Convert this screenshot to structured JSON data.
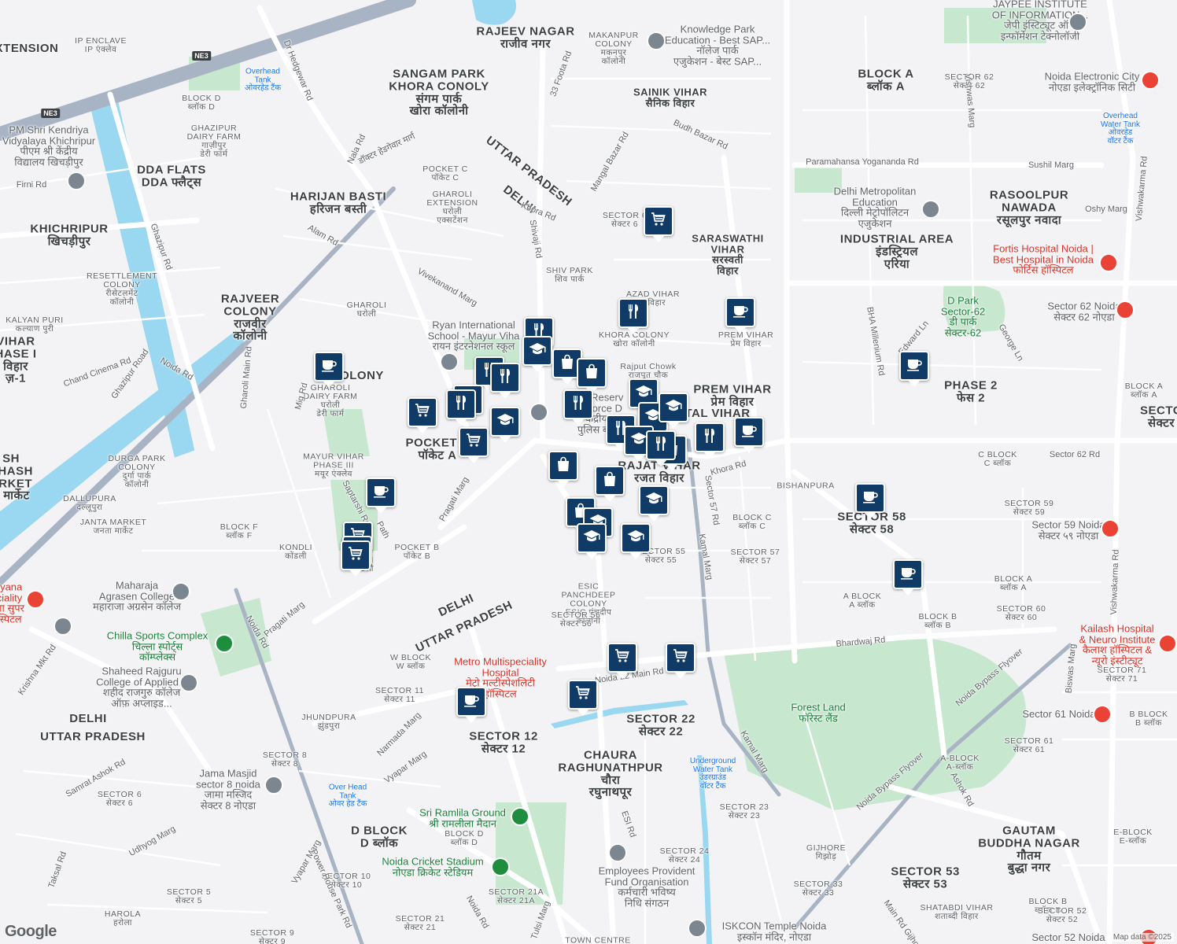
{
  "attribution": "Map data ©2025",
  "logo": "Google",
  "highway_shields": [
    "NE3",
    "NE3"
  ],
  "colors": {
    "marker": "#0f3b66",
    "water": "#9ad7f0",
    "park": "#c7e7cf",
    "highway": "#a8b4c4"
  },
  "areas": [
    {
      "id": "rajeev-nagar",
      "text": "RAJEEV NAGAR\nराजीव नगर",
      "cls": "area"
    },
    {
      "id": "sangam-park",
      "text": "SANGAM PARK\nKHORA CONOLY\nसंगम पार्क\nखोरा कॉलोनी",
      "cls": "area"
    },
    {
      "id": "extension",
      "text": "XTENSION",
      "cls": "area"
    },
    {
      "id": "dda-flats",
      "text": "DDA FLATS\nDDA फ्लैट्स",
      "cls": "area"
    },
    {
      "id": "harijan-basti",
      "text": "HARIJAN BASTI\nहरिजन बस्ती",
      "cls": "area"
    },
    {
      "id": "khichripur",
      "text": "KHICHRIPUR\nखिचड़ीपुर",
      "cls": "area"
    },
    {
      "id": "rajveer-colony",
      "text": "RAJVEER\nCOLONY\nराजवीर\nकॉलोनी",
      "cls": "area"
    },
    {
      "id": "vihar-phase",
      "text": "VIHAR\nHASE I\nविहार\nज़-1",
      "cls": "area"
    },
    {
      "id": "colony-w",
      "text": "OLONY",
      "cls": "area"
    },
    {
      "id": "pocket-a",
      "text": "POCKET A\nपॉकेट A",
      "cls": "area"
    },
    {
      "id": "subhash-market",
      "text": "SH\nBHASH\nARKET\nष मार्केट",
      "cls": "area"
    },
    {
      "id": "uttar-pradesh-n",
      "text": "UTTAR PRADESH",
      "cls": "area"
    },
    {
      "id": "delhi-n",
      "text": "DELHI",
      "cls": "area"
    },
    {
      "id": "block-a",
      "text": "BLOCK A\nब्लॉक A",
      "cls": "area"
    },
    {
      "id": "rasoolpur",
      "text": "RASOOLPUR\nNAWADA\nरसूलपुर नवादा",
      "cls": "area"
    },
    {
      "id": "industrial-area",
      "text": "INDUSTRIAL AREA\nइंडस्ट्रियल\nएरिया",
      "cls": "area"
    },
    {
      "id": "prem-vihar",
      "text": "PREM VIHAR\nप्रेम विहार",
      "cls": "area"
    },
    {
      "id": "sheetal-vihar",
      "text": "TAL VIHAR",
      "cls": "area"
    },
    {
      "id": "rajat-vihar",
      "text": "RAJAT VIHAR\nरजत विहार",
      "cls": "area"
    },
    {
      "id": "phase-2",
      "text": "PHASE 2\nफेस 2",
      "cls": "area"
    },
    {
      "id": "sector-58",
      "text": "SECTOR 58\nसेक्टर 58",
      "cls": "area"
    },
    {
      "id": "sector-n",
      "text": "SECTO\nसेक्टर",
      "cls": "area"
    },
    {
      "id": "delhi-s",
      "text": "DELHI",
      "cls": "area"
    },
    {
      "id": "uttar-pradesh-s",
      "text": "UTTAR PRADESH",
      "cls": "area"
    },
    {
      "id": "delhi-sw",
      "text": "DELHI",
      "cls": "area"
    },
    {
      "id": "uttar-pradesh-sw",
      "text": "UTTAR PRADESH",
      "cls": "area"
    },
    {
      "id": "sector-12",
      "text": "SECTOR 12\nसेक्टर 12",
      "cls": "area"
    },
    {
      "id": "sector-22",
      "text": "SECTOR 22\nसेक्टर 22",
      "cls": "area"
    },
    {
      "id": "chaura",
      "text": "CHAURA\nRAGHUNATHPUR\nचौरा\nरघुनाथपूर",
      "cls": "area"
    },
    {
      "id": "d-block",
      "text": "D BLOCK\nD ब्लॉक",
      "cls": "area"
    },
    {
      "id": "gautam-buddha",
      "text": "GAUTAM\nBUDDHA NAGAR\nगौतम\nबुद्धा नगर",
      "cls": "area"
    },
    {
      "id": "sector-53",
      "text": "SECTOR 53\nसेक्टर 53",
      "cls": "area"
    }
  ],
  "small_labels": [
    {
      "id": "ip-enclave",
      "text": "IP ENCLAVE\nIP एंक्लेव"
    },
    {
      "id": "block-d-n",
      "text": "BLOCK D\nब्लॉक D"
    },
    {
      "id": "ghazipur-dairy",
      "text": "GHAZIPUR\nDAIRY FARM\nगाज़ीपुर\nडेरी फार्म"
    },
    {
      "id": "pocket-c",
      "text": "POCKET C\nपॉकेट C"
    },
    {
      "id": "gharoli-ext",
      "text": "GHAROLI\nEXTENSION\nघरोली\nएक्सटेंशन"
    },
    {
      "id": "makanpur",
      "text": "MAKANPUR\nCOLONY\nमकनपुर\nकॉलोनी"
    },
    {
      "id": "sainik-vihar",
      "text": "SAINIK VIHAR\nसैनिक विहार",
      "area": true
    },
    {
      "id": "sector-6x",
      "text": "SECTOR 6\nसेक्टर 6"
    },
    {
      "id": "saraswathi",
      "text": "SARASWATHI\nVIHAR\nसरस्वती\nविहार",
      "area": true
    },
    {
      "id": "shiv-park",
      "text": "SHIV PARK\nशिव पार्क"
    },
    {
      "id": "azad-vihar",
      "text": "AZAD VIHAR\nद विहार"
    },
    {
      "id": "khora-colony",
      "text": "KHORA COLONY\nखोरा कॉलोनी"
    },
    {
      "id": "prem-vihar-s",
      "text": "PREM VIHAR\nप्रेम विहार"
    },
    {
      "id": "rajput-chowk",
      "text": "Rajput Chowk\nराजपूत चौक"
    },
    {
      "id": "resettlement",
      "text": "RESETTLEMENT\nCOLONY\nरीसेटलमेंट\nकॉलोनी"
    },
    {
      "id": "kalyan-puri",
      "text": "KALYAN PURI\nकल्याण पुरी"
    },
    {
      "id": "gharoli",
      "text": "GHAROLI\nघरोली"
    },
    {
      "id": "gharoli-dairy",
      "text": "GHAROLI\nDAIRY FARM\nघरोली\nडेरी फार्म"
    },
    {
      "id": "durga-park",
      "text": "DURGA PARK\nCOLONY\nदुर्गा पार्क\nकॉलोनी"
    },
    {
      "id": "dallupura",
      "text": "DALLUPURA\nदल्लूपुरा"
    },
    {
      "id": "janta-market",
      "text": "JANTA MARKET\nजनता मार्केट"
    },
    {
      "id": "mayur-vihar-3",
      "text": "MAYUR VIHAR\nPHASE III\nमयूर एंक्लेव"
    },
    {
      "id": "block-f",
      "text": "BLOCK F\nब्लॉक F"
    },
    {
      "id": "kondli",
      "text": "KONDLI\nकोंडली"
    },
    {
      "id": "kondli-2",
      "text": "NDLI\nोंडली"
    },
    {
      "id": "pocket-b",
      "text": "POCKET B\nपॉकेट B"
    },
    {
      "id": "sector-55",
      "text": "SECTOR 55\nसेक्टर 55"
    },
    {
      "id": "sector-57",
      "text": "SECTOR 57\nसेक्टर 57"
    },
    {
      "id": "block-c",
      "text": "BLOCK C\nब्लॉक C"
    },
    {
      "id": "bishanpura",
      "text": "BISHANPURA"
    },
    {
      "id": "esic",
      "text": "ESIC\nPANCHDEEP\nCOLONY\nESIC पंचदीप\nकॉलोनी"
    },
    {
      "id": "sector-56",
      "text": "SECTOR 56\nसेक्टर 56"
    },
    {
      "id": "w-block",
      "text": "W BLOCK\nW ब्लॉक"
    },
    {
      "id": "sector-11",
      "text": "SECTOR 11\nसेक्टर 11"
    },
    {
      "id": "jhundpura",
      "text": "JHUNDPURA\nझुंडपुरा"
    },
    {
      "id": "sector-8",
      "text": "SECTOR 8\nसेक्टर 8"
    },
    {
      "id": "sector-6",
      "text": "SECTOR 6\nसेक्टर 6"
    },
    {
      "id": "sector-5",
      "text": "SECTOR 5\nसेक्टर 5"
    },
    {
      "id": "harola",
      "text": "HAROLA\nहरोला"
    },
    {
      "id": "sector-9",
      "text": "SECTOR 9\nसेक्टर 9"
    },
    {
      "id": "sector-10",
      "text": "SECTOR 10\nसेक्टर 10"
    },
    {
      "id": "block-d-s",
      "text": "BLOCK D\nब्लॉक D"
    },
    {
      "id": "sector-21a",
      "text": "SECTOR 21A\nसेक्टर 21A"
    },
    {
      "id": "sector-21",
      "text": "SECTOR 21\nसेक्टर 21"
    },
    {
      "id": "sector-23",
      "text": "SECTOR 23\nसेक्टर 23"
    },
    {
      "id": "sector-24",
      "text": "SECTOR 24\nसेक्टर 24"
    },
    {
      "id": "sector-33",
      "text": "SECTOR 33\nसेक्टर 33"
    },
    {
      "id": "sector-62",
      "text": "SECTOR 62\nसेक्टर 62"
    },
    {
      "id": "sector-59",
      "text": "SECTOR 59\nसेक्टर 59"
    },
    {
      "id": "c-block",
      "text": "C BLOCK\nC ब्लॉक"
    },
    {
      "id": "a-block-58",
      "text": "A BLOCK\nA ब्लॉक"
    },
    {
      "id": "block-b-60",
      "text": "BLOCK B\nब्लॉक B"
    },
    {
      "id": "block-a-60",
      "text": "BLOCK A\nब्लॉक A"
    },
    {
      "id": "sector-60",
      "text": "SECTOR 60\nसेक्टर 60"
    },
    {
      "id": "block-a-e",
      "text": "BLOCK A\nब्लॉक A"
    },
    {
      "id": "sector-71",
      "text": "SECTOR 71\nसेक्टर 71"
    },
    {
      "id": "b-block-e",
      "text": "B BLOCK\nB ब्लॉक"
    },
    {
      "id": "sector-61",
      "text": "SECTOR 61\nसेक्टर 61"
    },
    {
      "id": "a-block-53",
      "text": "A-BLOCK\nA-ब्लॉक"
    },
    {
      "id": "gijhore",
      "text": "GIJHORE\nगिझोड़"
    },
    {
      "id": "shatabdi",
      "text": "SHATABDI VIHAR\nशताब्दी विहार"
    },
    {
      "id": "block-b-s",
      "text": "BLOCK B\nब्लॉक B"
    },
    {
      "id": "sector-52",
      "text": "SECTOR 52\nसेक्टर 52"
    },
    {
      "id": "e-block",
      "text": "E-BLOCK\nE-ब्लॉक"
    },
    {
      "id": "town-centre",
      "text": "TOWN CENTRE"
    }
  ],
  "pois": [
    {
      "id": "knowledge-park",
      "text": "Knowledge Park\nEducation - Best SAP...\nनॉलेज पार्क\nएजुकेशन - बेस्ट SAP...",
      "cls": "poi"
    },
    {
      "id": "jaypee",
      "text": "JAYPEE INSTITUTE\nOF INFORMATION...\nजेपी इंस्टिट्यूट ऑफ\nइन्फॉर्मेशन टेक्नोलॉजी",
      "cls": "poi"
    },
    {
      "id": "noida-electronic",
      "text": "Noida Electronic City\nनोएडा इलेक्ट्रॉनिक सिटी",
      "cls": "poi"
    },
    {
      "id": "pm-shri",
      "text": "PM Shri Kendriya\nVidyalaya Khichripur\nपीएम श्री केंद्रीय\nविद्यालय खिचड़ीपुर",
      "cls": "poi"
    },
    {
      "id": "overhead-tank-1",
      "text": "Overhead\nTank\nओवरहेड टैंक",
      "cls": "poi blue small2"
    },
    {
      "id": "delhi-metropolitan",
      "text": "Delhi Metropolitan\nEducation\nदिल्ली मेट्रोपॉलिटन\nएजुकेशन",
      "cls": "poi"
    },
    {
      "id": "overhead-water-tank",
      "text": "Overhead\nWater Tank\nओवरहेड\nवॉटर टैंक",
      "cls": "poi blue small2"
    },
    {
      "id": "fortis",
      "text": "Fortis Hospital Noida |\nBest Hospital in Noida\nफोर्टिस हॉस्पिटल",
      "cls": "poi red"
    },
    {
      "id": "ryan",
      "text": "Ryan International\nSchool - Mayur Viha\nरायन इंटरनेशनल स्कूल",
      "cls": "poi"
    },
    {
      "id": "crpf",
      "text": "Cen Reserv\nPo Force D\nकेंद्रीय\nपुलिस बल",
      "cls": "poi"
    },
    {
      "id": "d-park",
      "text": "D Park\nSector-62\nडी पार्क\nसेक्टर-62",
      "cls": "poi green"
    },
    {
      "id": "sector-62-noida",
      "text": "Sector 62 Noida\nसेक्टर 62 नोएडा",
      "cls": "poi"
    },
    {
      "id": "sector-59-noida",
      "text": "Sector 59 Noida\nसेक्टर ५९ नोएडा",
      "cls": "poi"
    },
    {
      "id": "sector-61-noida",
      "text": "Sector 61 Noida",
      "cls": "poi"
    },
    {
      "id": "sector-52-noida",
      "text": "Sector 52 Noida",
      "cls": "poi"
    },
    {
      "id": "kailash",
      "text": "Kailash Hospital\n& Neuro Institute\nकैलाश हॉस्पिटल &\nन्यूरो इंस्टीट्यूट",
      "cls": "poi red"
    },
    {
      "id": "haryana",
      "text": "ryana\nciality\nणा सुपर\nस्पिटल",
      "cls": "poi red"
    },
    {
      "id": "maharaja",
      "text": "Maharaja\nAgrasen College\nमहाराजा अग्रसेन कॉलेज",
      "cls": "poi"
    },
    {
      "id": "chilla",
      "text": "Chilla Sports Complex\nचिल्ला स्पोर्ट्स\nकॉम्प्लेक्स",
      "cls": "poi green"
    },
    {
      "id": "shaheed",
      "text": "Shaheed Rajguru\nCollege of Applied...\nशहीद राजगुरु कॉलेज\nऑफ़ अप्लाइड...",
      "cls": "poi"
    },
    {
      "id": "metro-hospital",
      "text": "Metro Multispeciality\nHospital\nमेट्रो मल्टीस्पेशलिटी\nहॉस्पिटल",
      "cls": "poi red"
    },
    {
      "id": "forest-land",
      "text": "Forest Land\nफॉरेस्ट लैंड",
      "cls": "poi green"
    },
    {
      "id": "underground-tank",
      "text": "Underground\nWater Tank\nउंडरग्राउंड\nवॉटर टैंक",
      "cls": "poi blue small2"
    },
    {
      "id": "jama-masjid",
      "text": "Jama Masjid\nsector 8 noida\nजामा मस्जिद\nसेक्टर 8 नोएडा",
      "cls": "poi"
    },
    {
      "id": "over-head-tank",
      "text": "Over Head\nTank\nओवर हेड टैंक",
      "cls": "poi blue small2"
    },
    {
      "id": "ramlila",
      "text": "Sri Ramlila Ground\nश्री रामलीला मैदान",
      "cls": "poi green"
    },
    {
      "id": "cricket-stadium",
      "text": "Noida Cricket Stadium\nनोएडा क्रिकेट स्टेडियम",
      "cls": "poi green"
    },
    {
      "id": "epfo",
      "text": "Employees Provident\nFund Organisation\nकर्मचारी भविष्य\nनिधि संगठन",
      "cls": "poi"
    },
    {
      "id": "iskcon",
      "text": "ISKCON Temple Noida\nइस्कॉन मंदिर, नोएडा",
      "cls": "poi"
    }
  ],
  "roads": [
    {
      "id": "dr-hedgewar-rd",
      "text": "Dr Hedgewar Rd"
    },
    {
      "id": "nala-rd",
      "text": "Nala Rd"
    },
    {
      "id": "hedgewar-marg",
      "text": "डॉक्टर हेडगेवार मार्ग"
    },
    {
      "id": "33-foota-rd",
      "text": "33 Foota Rd"
    },
    {
      "id": "mangal-bazar-rd",
      "text": "Mangal Bazar Rd"
    },
    {
      "id": "budh-bazar-rd",
      "text": "Budh Bazar Rd"
    },
    {
      "id": "delhi-khora-rd",
      "text": "Khora Rd"
    },
    {
      "id": "shivaji-rd",
      "text": "Shivaji Rd"
    },
    {
      "id": "firni-rd",
      "text": "Firni Rd"
    },
    {
      "id": "ghazipur-rd",
      "text": "Ghazipur Rd"
    },
    {
      "id": "alam-rd",
      "text": "Alam Rd"
    },
    {
      "id": "vivekanand-marg",
      "text": "Vivekanand Marg"
    },
    {
      "id": "chand-cinema-rd",
      "text": "Chand Cinema Rd"
    },
    {
      "id": "ghazipur-road",
      "text": "Ghazipur Road"
    },
    {
      "id": "noida-rd-w",
      "text": "Noida Rd"
    },
    {
      "id": "gharoli-main-rd",
      "text": "Gharoli Main Rd"
    },
    {
      "id": "mig-rd",
      "text": "Mig Rd"
    },
    {
      "id": "pragati-marg-n",
      "text": "Pragati Marg"
    },
    {
      "id": "saptarshi-rd",
      "text": "Saptarshi Rd"
    },
    {
      "id": "mandir-marg",
      "text": "Path"
    },
    {
      "id": "pragati-marg-s",
      "text": "Pragati Marg"
    },
    {
      "id": "noida-rd-mid",
      "text": "Noida Rd"
    },
    {
      "id": "krishna-mkt-rd",
      "text": "Krishna Mkt Rd"
    },
    {
      "id": "narmada-marg",
      "text": "Narmada Marg"
    },
    {
      "id": "vyapar-marg-1",
      "text": "Vyapar Marg"
    },
    {
      "id": "samrat-ashok-rd",
      "text": "Samrat Ashok Rd"
    },
    {
      "id": "udhyog-marg",
      "text": "Udhyog Marg"
    },
    {
      "id": "taksal-rd",
      "text": "Taksal Rd"
    },
    {
      "id": "vyapar-marg-2",
      "text": "Vyapar Marg"
    },
    {
      "id": "power-house-rd",
      "text": "Power House Park Rd"
    },
    {
      "id": "noida-rd-s",
      "text": "Noida Rd"
    },
    {
      "id": "tulsi-marg",
      "text": "Tulsi Marg"
    },
    {
      "id": "noida-22-main-rd",
      "text": "Noida 22 Main Rd"
    },
    {
      "id": "esi-rd",
      "text": "ESI Rd"
    },
    {
      "id": "kamal-marg-n",
      "text": "Kamal Marg"
    },
    {
      "id": "kamal-marg-s",
      "text": "Kamal Marg"
    },
    {
      "id": "sector-57-rd",
      "text": "Sector 57 Rd"
    },
    {
      "id": "khora-rd",
      "text": "Khora Rd"
    },
    {
      "id": "bhardwaj-rd",
      "text": "Bhardwaj Rd"
    },
    {
      "id": "sector-62-rd",
      "text": "Sector 62 Rd"
    },
    {
      "id": "vishwas-marg",
      "text": "Vishwas Marg"
    },
    {
      "id": "paramahansa-rd",
      "text": "Paramahansa Yogananda Rd"
    },
    {
      "id": "sushil-marg",
      "text": "Sushil Marg"
    },
    {
      "id": "oshy-marg",
      "text": "Oshy Marg"
    },
    {
      "id": "bha-millenium-rd",
      "text": "BHA Millenium Rd"
    },
    {
      "id": "edward-ln",
      "text": "Edward Ln"
    },
    {
      "id": "george-ln",
      "text": "George Ln"
    },
    {
      "id": "vishwakarma-rd-n",
      "text": "Vishwakarma Rd"
    },
    {
      "id": "vishwakarma-rd-s",
      "text": "Vishwakarma Rd"
    },
    {
      "id": "noida-bypass-1",
      "text": "Noida Bypass Flyover"
    },
    {
      "id": "noida-bypass-2",
      "text": "Noida Bypass Flyover"
    },
    {
      "id": "biswas-marg",
      "text": "Biswas Marg"
    },
    {
      "id": "ashok-rd",
      "text": "Ashok Rd"
    },
    {
      "id": "main-rd-gijhor",
      "text": "Main Rd Gijhor"
    }
  ],
  "markers": [
    {
      "type": "grocery-cart",
      "name": "marker-grocery-1"
    },
    {
      "type": "restaurant",
      "name": "marker-restaurant-1"
    },
    {
      "type": "cafe",
      "name": "marker-cafe-1"
    },
    {
      "type": "restaurant",
      "name": "marker-restaurant-2"
    },
    {
      "type": "school",
      "name": "marker-school-1"
    },
    {
      "type": "shopping-bag",
      "name": "marker-shopping-1"
    },
    {
      "type": "shopping-bag",
      "name": "marker-shopping-2"
    },
    {
      "type": "restaurant",
      "name": "marker-restaurant-3"
    },
    {
      "type": "restaurant",
      "name": "marker-restaurant-4"
    },
    {
      "type": "restaurant",
      "name": "marker-restaurant-5"
    },
    {
      "type": "cafe",
      "name": "marker-cafe-2"
    },
    {
      "type": "grocery-cart",
      "name": "marker-grocery-2"
    },
    {
      "type": "restaurant",
      "name": "marker-restaurant-6"
    },
    {
      "type": "restaurant",
      "name": "marker-restaurant-7"
    },
    {
      "type": "school",
      "name": "marker-school-2"
    },
    {
      "type": "grocery-cart",
      "name": "marker-grocery-3"
    },
    {
      "type": "restaurant",
      "name": "marker-restaurant-8"
    },
    {
      "type": "school",
      "name": "marker-school-3"
    },
    {
      "type": "school",
      "name": "marker-school-4"
    },
    {
      "type": "school",
      "name": "marker-school-5"
    },
    {
      "type": "restaurant",
      "name": "marker-restaurant-9"
    },
    {
      "type": "school",
      "name": "marker-school-6"
    },
    {
      "type": "shopping-bag",
      "name": "marker-shopping-3"
    },
    {
      "type": "restaurant",
      "name": "marker-restaurant-10"
    },
    {
      "type": "cafe",
      "name": "marker-cafe-3"
    },
    {
      "type": "shopping-bag",
      "name": "marker-shopping-4"
    },
    {
      "type": "shopping-bag",
      "name": "marker-shopping-5"
    },
    {
      "type": "school",
      "name": "marker-school-7"
    },
    {
      "type": "shopping-bag",
      "name": "marker-shopping-6"
    },
    {
      "type": "school",
      "name": "marker-school-8"
    },
    {
      "type": "school",
      "name": "marker-school-9"
    },
    {
      "type": "school",
      "name": "marker-school-10"
    },
    {
      "type": "cafe",
      "name": "marker-cafe-4"
    },
    {
      "type": "cafe",
      "name": "marker-cafe-5"
    },
    {
      "type": "cafe",
      "name": "marker-cafe-6"
    },
    {
      "type": "cafe",
      "name": "marker-cafe-7"
    },
    {
      "type": "grocery-cart",
      "name": "marker-grocery-4"
    },
    {
      "type": "grocery-cart",
      "name": "marker-grocery-5"
    },
    {
      "type": "grocery-cart",
      "name": "marker-grocery-6"
    },
    {
      "type": "grocery-cart",
      "name": "marker-grocery-7"
    },
    {
      "type": "grocery-cart",
      "name": "marker-grocery-8"
    },
    {
      "type": "grocery-cart",
      "name": "marker-grocery-9"
    },
    {
      "type": "cafe",
      "name": "marker-cafe-8"
    }
  ]
}
